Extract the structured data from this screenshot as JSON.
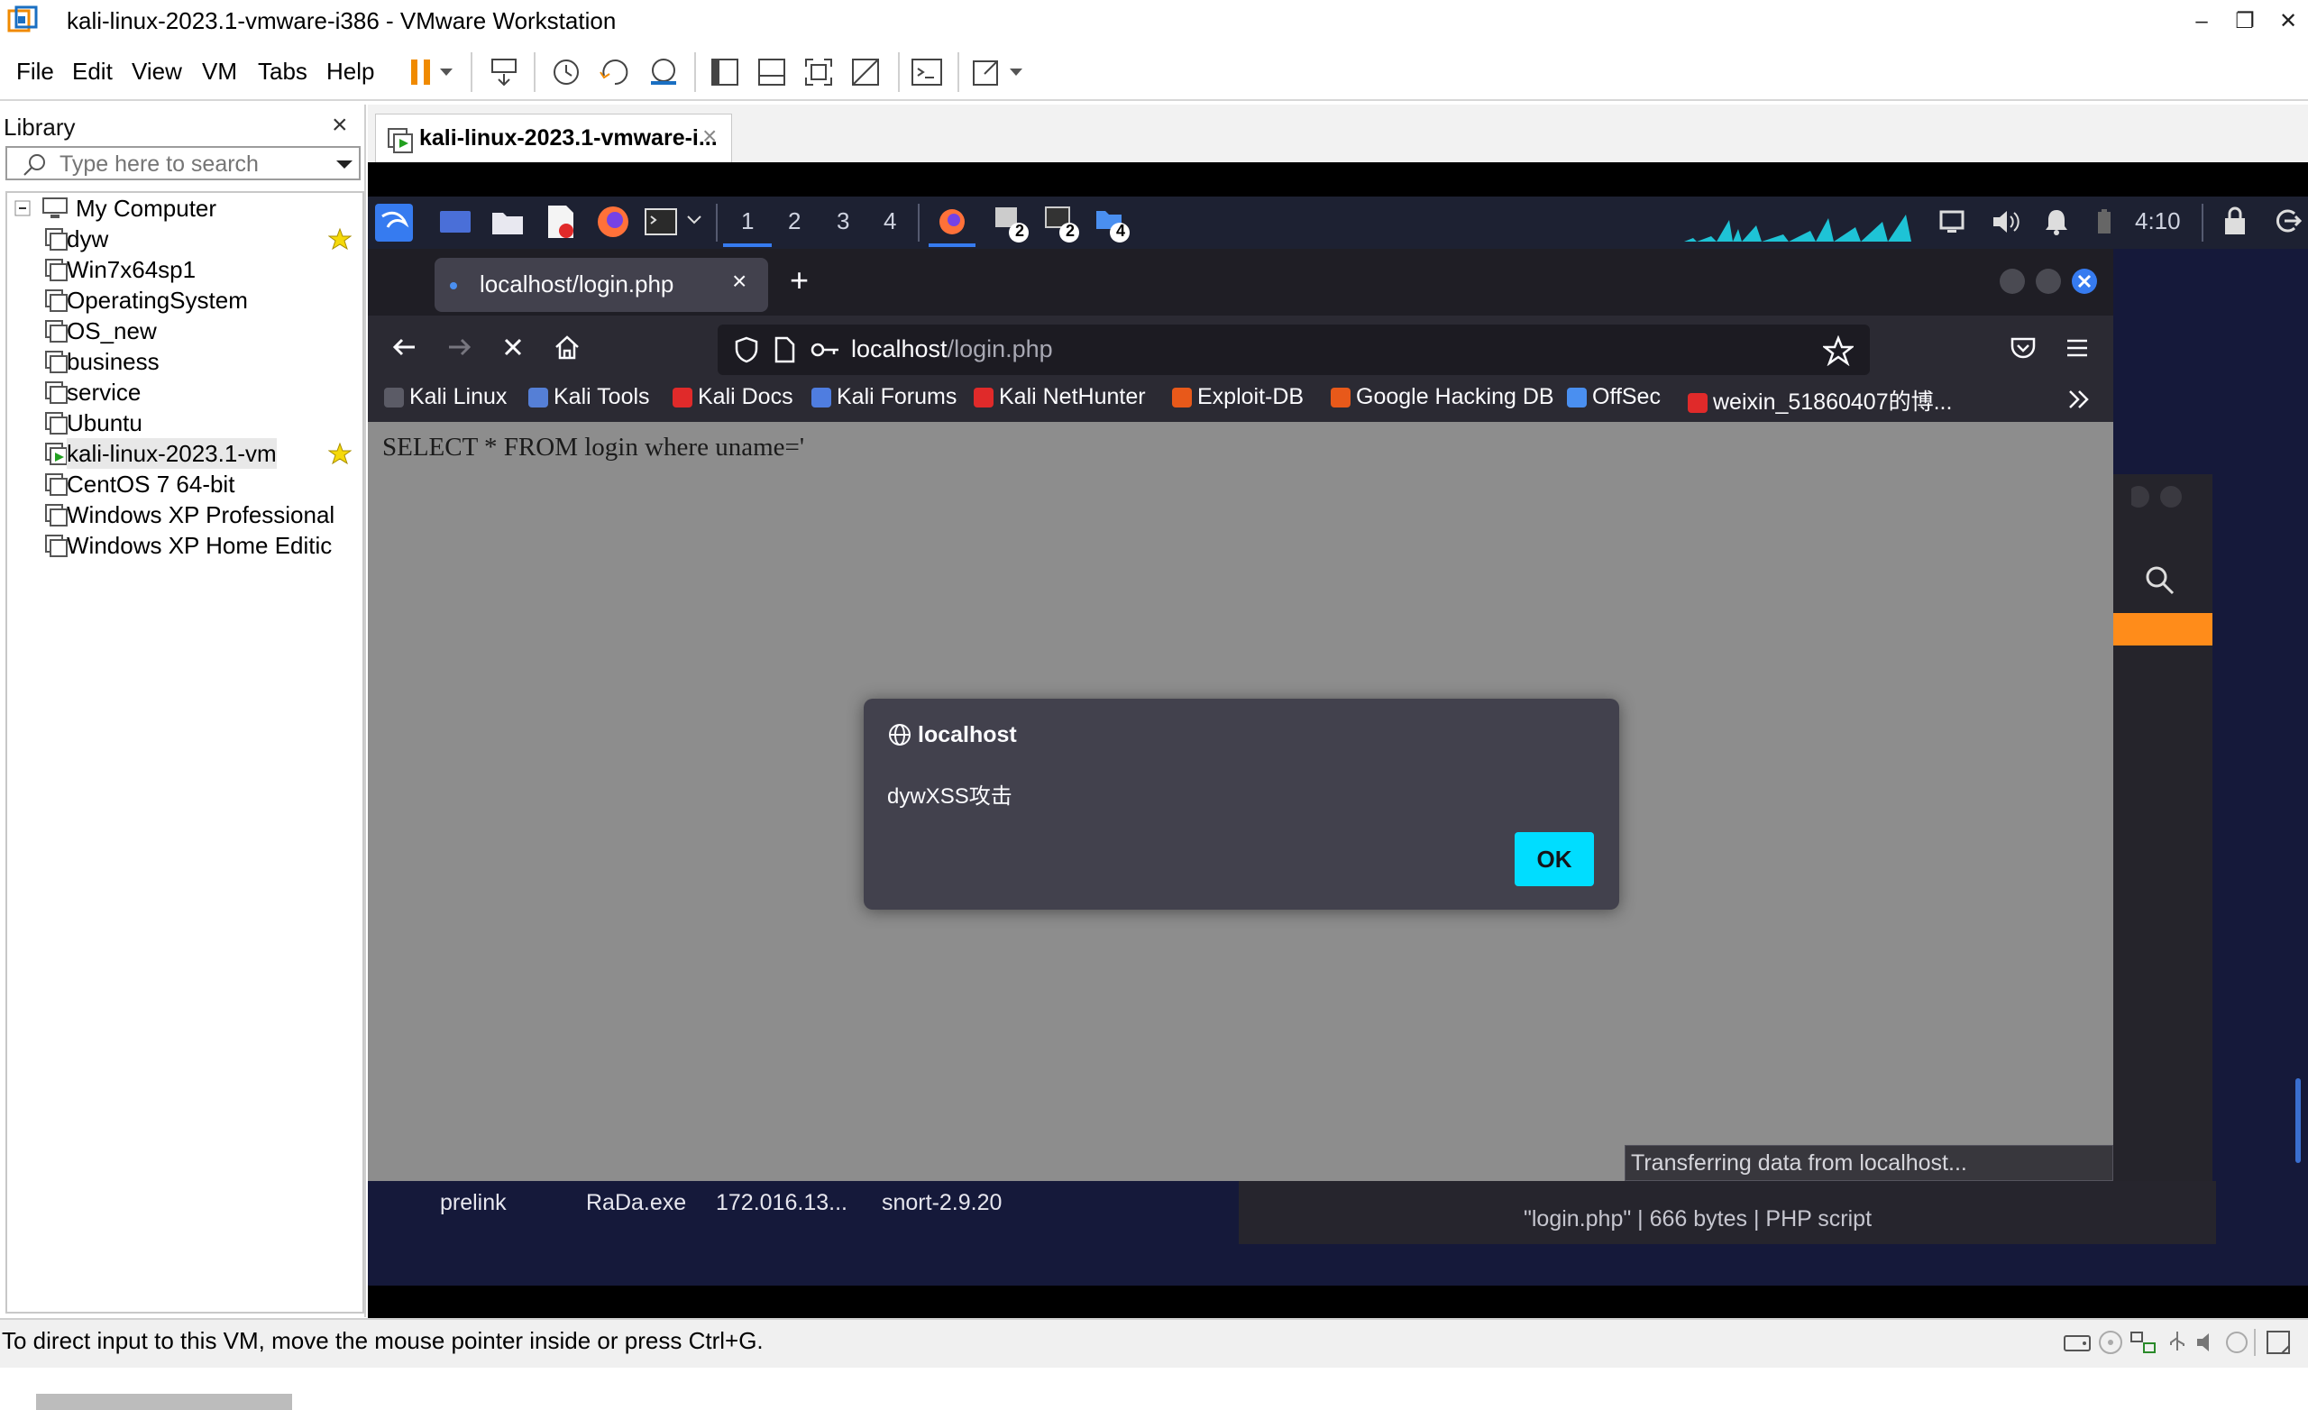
{
  "window": {
    "title": "kali-linux-2023.1-vmware-i386 - VMware Workstation",
    "minimize_glyph": "–",
    "restore_glyph": "❐",
    "close_glyph": "✕"
  },
  "menu": {
    "items": [
      "File",
      "Edit",
      "View",
      "VM",
      "Tabs",
      "Help"
    ]
  },
  "toolbar": {
    "icons": [
      "pause-icon",
      "dropdown-icon",
      "send-ctrl-alt-del-icon",
      "snapshot-icon",
      "revert-snapshot-icon",
      "snapshot-manager-icon",
      "library-view-icon",
      "thumbnail-view-icon",
      "full-screen-icon",
      "unity-icon",
      "console-icon",
      "stretch-icon"
    ]
  },
  "library": {
    "title": "Library",
    "close_glyph": "×",
    "search_placeholder": "Type here to search",
    "root": "My Computer",
    "vms": [
      {
        "name": "dyw",
        "favorite": true
      },
      {
        "name": "Win7x64sp1",
        "favorite": false
      },
      {
        "name": "OperatingSystem",
        "favorite": false
      },
      {
        "name": "OS_new",
        "favorite": false
      },
      {
        "name": "business",
        "favorite": false
      },
      {
        "name": "service",
        "favorite": false
      },
      {
        "name": "Ubuntu",
        "favorite": false
      },
      {
        "name": "kali-linux-2023.1-vm",
        "favorite": true,
        "running": true
      },
      {
        "name": "CentOS 7 64-bit",
        "favorite": false
      },
      {
        "name": "Windows XP Professional",
        "favorite": false
      },
      {
        "name": "Windows XP Home Editic",
        "favorite": false
      }
    ]
  },
  "vm_tab": {
    "label": "kali-linux-2023.1-vmware-i...",
    "close_glyph": "×"
  },
  "kali_panel": {
    "workspaces": [
      "1",
      "2",
      "3",
      "4"
    ],
    "badges": [
      "2",
      "2",
      "4"
    ],
    "clock": "4:10"
  },
  "firefox": {
    "tab_title": "localhost/login.php",
    "tab_close": "×",
    "new_tab": "+",
    "url_host": "localhost",
    "url_path": "/login.php",
    "bookmarks": [
      {
        "label": "Kali Linux",
        "color": "#5b5b66"
      },
      {
        "label": "Kali Tools",
        "color": "#557fd6"
      },
      {
        "label": "Kali Docs",
        "color": "#e02a2a"
      },
      {
        "label": "Kali Forums",
        "color": "#4f7de0"
      },
      {
        "label": "Kali NetHunter",
        "color": "#e02a2a"
      },
      {
        "label": "Exploit-DB",
        "color": "#e8591a"
      },
      {
        "label": "Google Hacking DB",
        "color": "#e8591a"
      },
      {
        "label": "OffSec",
        "color": "#4a8ff0"
      },
      {
        "label": "weixin_51860407的博...",
        "color": "#e02a2a"
      }
    ],
    "page_text": "SELECT * FROM login where uname='",
    "status": "Transferring data from localhost..."
  },
  "alert": {
    "origin": "localhost",
    "message": "dywXSS攻击",
    "ok_label": "OK"
  },
  "desktop": {
    "icons": [
      "prelink",
      "RaDa.exe",
      "172.016.13...",
      "snort-2.9.20"
    ],
    "file_info": "\"login.php\" | 666 bytes | PHP script"
  },
  "statusbar": {
    "text": "To direct input to this VM, move the mouse pointer inside or press Ctrl+G."
  },
  "colors": {
    "accent_cyan": "#00ddff",
    "kali_blue": "#367bf0",
    "orange": "#ff8c1a"
  }
}
